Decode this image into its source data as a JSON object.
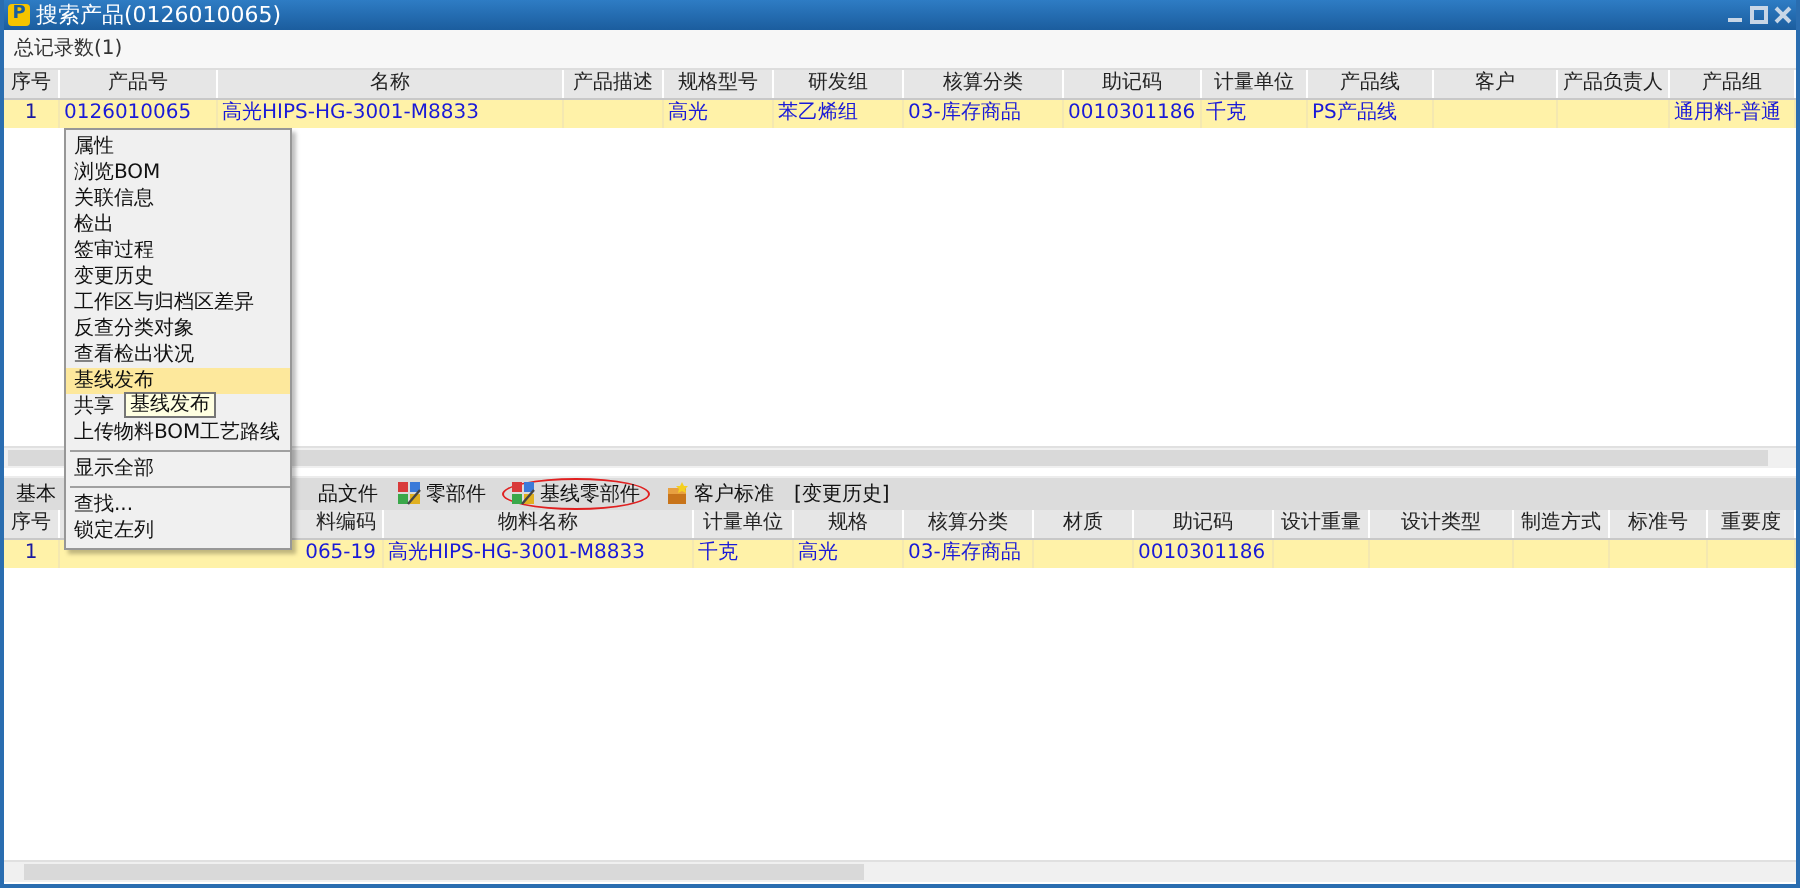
{
  "window": {
    "logo": "P",
    "title": "搜索产品(0126010065)"
  },
  "record_count": "总记录数(1)",
  "top_table": {
    "columns": [
      "序号",
      "产品号",
      "名称",
      "产品描述",
      "规格型号",
      "研发组",
      "核算分类",
      "助记码",
      "计量单位",
      "产品线",
      "客户",
      "产品负责人",
      "产品组"
    ],
    "rows": [
      {
        "selected": true,
        "cells": [
          "1",
          "0126010065",
          "高光HIPS-HG-3001-M8833",
          null,
          "高光",
          "苯乙烯组",
          "03-库存商品",
          "0010301186",
          "千克",
          "PS产品线",
          null,
          null,
          "通用料-普通"
        ]
      }
    ]
  },
  "tabs": [
    {
      "label": "基本",
      "kind": "text",
      "circled": false
    },
    {
      "label": "品文件",
      "kind": "text",
      "circled": false
    },
    {
      "label": "零部件",
      "kind": "parts",
      "circled": false
    },
    {
      "label": "基线零部件",
      "kind": "parts",
      "circled": true
    },
    {
      "label": "客户标准",
      "kind": "box",
      "circled": false
    },
    {
      "label": "[变更历史]",
      "kind": "text",
      "circled": false
    }
  ],
  "bottom_table": {
    "columns": [
      "序号",
      "料编码",
      "物料名称",
      "计量单位",
      "规格",
      "核算分类",
      "材质",
      "助记码",
      "设计重量",
      "设计类型",
      "制造方式",
      "标准号",
      "重要度"
    ],
    "rows": [
      {
        "selected": true,
        "cells": [
          "1",
          "065-19",
          "高光HIPS-HG-3001-M8833",
          "千克",
          "高光",
          "03-库存商品",
          null,
          "0010301186",
          null,
          null,
          null,
          null,
          null
        ]
      }
    ]
  },
  "context_menu": {
    "groups": [
      [
        {
          "label": "属性",
          "selected": false
        },
        {
          "label": "浏览BOM",
          "selected": false
        },
        {
          "label": "关联信息",
          "selected": false
        },
        {
          "label": "检出",
          "selected": false
        },
        {
          "label": "签审过程",
          "selected": false
        },
        {
          "label": "变更历史",
          "selected": false
        },
        {
          "label": "工作区与归档区差异",
          "selected": false
        },
        {
          "label": "反查分类对象",
          "selected": false
        },
        {
          "label": "查看检出状况",
          "selected": false
        },
        {
          "label": "基线发布",
          "selected": true
        },
        {
          "label": "共享",
          "selected": false
        },
        {
          "label": "上传物料BOM工艺路线",
          "selected": false
        }
      ],
      [
        {
          "label": "显示全部",
          "selected": false
        }
      ],
      [
        {
          "label": "查找...",
          "selected": false
        },
        {
          "label": "锁定左列",
          "selected": false
        }
      ]
    ]
  },
  "tooltip": {
    "text": "基线发布"
  }
}
